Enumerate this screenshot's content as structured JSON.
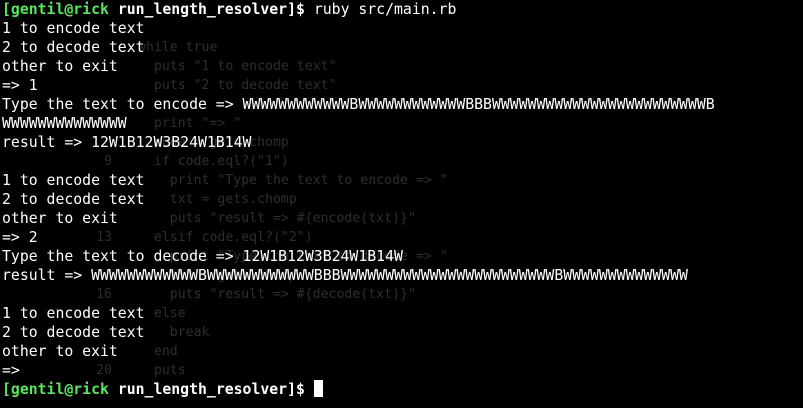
{
  "terminal": {
    "background": "#000000",
    "prompt_color": "#55e85a",
    "text_color": "#ffffff",
    "prompt_user_host": "[gentil@rick",
    "prompt_dir": "run_length_resolver",
    "prompt_end": "]$",
    "command": "ruby src/main.rb",
    "menu": {
      "line1": "1 to encode text",
      "line2": "2 to decode text",
      "line3": "other to exit"
    },
    "session1": {
      "choice": "=> 1",
      "ask": "Type the text to encode => ",
      "input_part1": "WWWWWWWWWWWWBWWWWWWWWWWWWBBBWWWWWWWWWWWWWWWWWWWWWWWWB",
      "input_part2": "WWWWWWWWWWWWWW",
      "result": "result => 12W1B12W3B24W1B14W"
    },
    "session2": {
      "choice": "=> 2",
      "ask": "Type the text to decode => ",
      "input": "12W1B12W3B24W1B14W",
      "result": "result => WWWWWWWWWWWWBWWWWWWWWWWWWBBBWWWWWWWWWWWWWWWWWWWWWWWWBWWWWWWWWWWWWWW"
    },
    "session3": {
      "choice": "=>"
    }
  },
  "editor": {
    "lines": [
      {
        "num": "",
        "code": "while true"
      },
      {
        "num": "",
        "code": "  puts \"1 to encode text\""
      },
      {
        "num": "",
        "code": "  puts \"2 to decode text\""
      },
      {
        "num": "",
        "code": ""
      },
      {
        "num": "",
        "code": "  print \"=> \""
      },
      {
        "num": "",
        "code": "  code = gets.chomp"
      },
      {
        "num": "9",
        "code": "  if code.eql?(\"1\")"
      },
      {
        "num": "",
        "code": "    print \"Type the text to encode => \""
      },
      {
        "num": "",
        "code": "    txt = gets.chomp"
      },
      {
        "num": "",
        "code": "    puts \"result => #{encode(txt)}\""
      },
      {
        "num": "13",
        "code": "  elsif code.eql?(\"2\")"
      },
      {
        "num": "",
        "code": "    print \"Type the text to decode => \""
      },
      {
        "num": "",
        "code": "    txt = gets.chomp"
      },
      {
        "num": "16",
        "code": "    puts \"result => #{decode(txt)}\""
      },
      {
        "num": "",
        "code": "  else"
      },
      {
        "num": "",
        "code": "    break"
      },
      {
        "num": "",
        "code": "  end"
      },
      {
        "num": "20",
        "code": "  puts"
      }
    ]
  }
}
